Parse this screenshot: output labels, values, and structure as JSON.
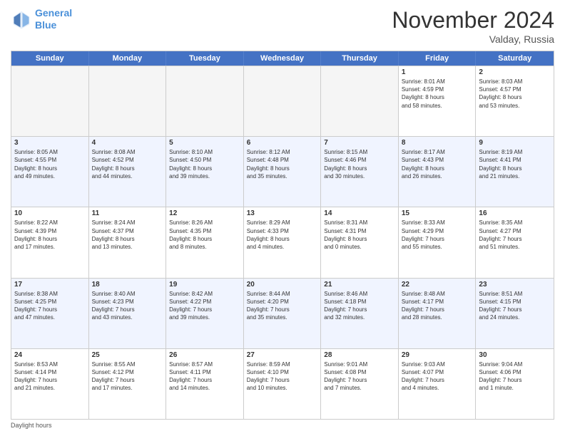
{
  "logo": {
    "line1": "General",
    "line2": "Blue"
  },
  "title": "November 2024",
  "subtitle": "Valday, Russia",
  "headers": [
    "Sunday",
    "Monday",
    "Tuesday",
    "Wednesday",
    "Thursday",
    "Friday",
    "Saturday"
  ],
  "footer": "Daylight hours",
  "rows": [
    [
      {
        "day": "",
        "text": "",
        "empty": true
      },
      {
        "day": "",
        "text": "",
        "empty": true
      },
      {
        "day": "",
        "text": "",
        "empty": true
      },
      {
        "day": "",
        "text": "",
        "empty": true
      },
      {
        "day": "",
        "text": "",
        "empty": true
      },
      {
        "day": "1",
        "text": "Sunrise: 8:01 AM\nSunset: 4:59 PM\nDaylight: 8 hours\nand 58 minutes."
      },
      {
        "day": "2",
        "text": "Sunrise: 8:03 AM\nSunset: 4:57 PM\nDaylight: 8 hours\nand 53 minutes."
      }
    ],
    [
      {
        "day": "3",
        "text": "Sunrise: 8:05 AM\nSunset: 4:55 PM\nDaylight: 8 hours\nand 49 minutes."
      },
      {
        "day": "4",
        "text": "Sunrise: 8:08 AM\nSunset: 4:52 PM\nDaylight: 8 hours\nand 44 minutes."
      },
      {
        "day": "5",
        "text": "Sunrise: 8:10 AM\nSunset: 4:50 PM\nDaylight: 8 hours\nand 39 minutes."
      },
      {
        "day": "6",
        "text": "Sunrise: 8:12 AM\nSunset: 4:48 PM\nDaylight: 8 hours\nand 35 minutes."
      },
      {
        "day": "7",
        "text": "Sunrise: 8:15 AM\nSunset: 4:46 PM\nDaylight: 8 hours\nand 30 minutes."
      },
      {
        "day": "8",
        "text": "Sunrise: 8:17 AM\nSunset: 4:43 PM\nDaylight: 8 hours\nand 26 minutes."
      },
      {
        "day": "9",
        "text": "Sunrise: 8:19 AM\nSunset: 4:41 PM\nDaylight: 8 hours\nand 21 minutes."
      }
    ],
    [
      {
        "day": "10",
        "text": "Sunrise: 8:22 AM\nSunset: 4:39 PM\nDaylight: 8 hours\nand 17 minutes."
      },
      {
        "day": "11",
        "text": "Sunrise: 8:24 AM\nSunset: 4:37 PM\nDaylight: 8 hours\nand 13 minutes."
      },
      {
        "day": "12",
        "text": "Sunrise: 8:26 AM\nSunset: 4:35 PM\nDaylight: 8 hours\nand 8 minutes."
      },
      {
        "day": "13",
        "text": "Sunrise: 8:29 AM\nSunset: 4:33 PM\nDaylight: 8 hours\nand 4 minutes."
      },
      {
        "day": "14",
        "text": "Sunrise: 8:31 AM\nSunset: 4:31 PM\nDaylight: 8 hours\nand 0 minutes."
      },
      {
        "day": "15",
        "text": "Sunrise: 8:33 AM\nSunset: 4:29 PM\nDaylight: 7 hours\nand 55 minutes."
      },
      {
        "day": "16",
        "text": "Sunrise: 8:35 AM\nSunset: 4:27 PM\nDaylight: 7 hours\nand 51 minutes."
      }
    ],
    [
      {
        "day": "17",
        "text": "Sunrise: 8:38 AM\nSunset: 4:25 PM\nDaylight: 7 hours\nand 47 minutes."
      },
      {
        "day": "18",
        "text": "Sunrise: 8:40 AM\nSunset: 4:23 PM\nDaylight: 7 hours\nand 43 minutes."
      },
      {
        "day": "19",
        "text": "Sunrise: 8:42 AM\nSunset: 4:22 PM\nDaylight: 7 hours\nand 39 minutes."
      },
      {
        "day": "20",
        "text": "Sunrise: 8:44 AM\nSunset: 4:20 PM\nDaylight: 7 hours\nand 35 minutes."
      },
      {
        "day": "21",
        "text": "Sunrise: 8:46 AM\nSunset: 4:18 PM\nDaylight: 7 hours\nand 32 minutes."
      },
      {
        "day": "22",
        "text": "Sunrise: 8:48 AM\nSunset: 4:17 PM\nDaylight: 7 hours\nand 28 minutes."
      },
      {
        "day": "23",
        "text": "Sunrise: 8:51 AM\nSunset: 4:15 PM\nDaylight: 7 hours\nand 24 minutes."
      }
    ],
    [
      {
        "day": "24",
        "text": "Sunrise: 8:53 AM\nSunset: 4:14 PM\nDaylight: 7 hours\nand 21 minutes."
      },
      {
        "day": "25",
        "text": "Sunrise: 8:55 AM\nSunset: 4:12 PM\nDaylight: 7 hours\nand 17 minutes."
      },
      {
        "day": "26",
        "text": "Sunrise: 8:57 AM\nSunset: 4:11 PM\nDaylight: 7 hours\nand 14 minutes."
      },
      {
        "day": "27",
        "text": "Sunrise: 8:59 AM\nSunset: 4:10 PM\nDaylight: 7 hours\nand 10 minutes."
      },
      {
        "day": "28",
        "text": "Sunrise: 9:01 AM\nSunset: 4:08 PM\nDaylight: 7 hours\nand 7 minutes."
      },
      {
        "day": "29",
        "text": "Sunrise: 9:03 AM\nSunset: 4:07 PM\nDaylight: 7 hours\nand 4 minutes."
      },
      {
        "day": "30",
        "text": "Sunrise: 9:04 AM\nSunset: 4:06 PM\nDaylight: 7 hours\nand 1 minute."
      }
    ]
  ]
}
